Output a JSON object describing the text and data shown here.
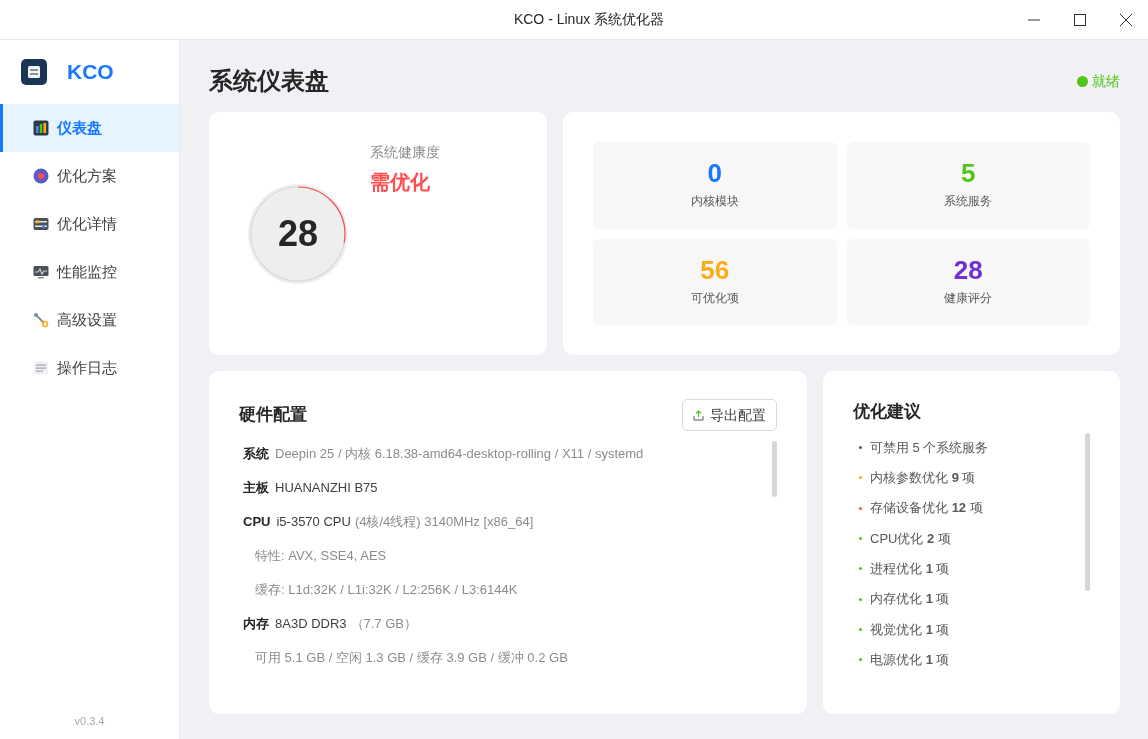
{
  "window": {
    "title": "KCO - Linux 系统优化器"
  },
  "sidebar": {
    "app_name": "KCO",
    "items": [
      {
        "label": "仪表盘",
        "selected": true
      },
      {
        "label": "优化方案",
        "selected": false
      },
      {
        "label": "优化详情",
        "selected": false
      },
      {
        "label": "性能监控",
        "selected": false
      },
      {
        "label": "高级设置",
        "selected": false
      },
      {
        "label": "操作日志",
        "selected": false
      }
    ],
    "version": "v0.3.4"
  },
  "header": {
    "title": "系统仪表盘",
    "status": {
      "label": "就绪",
      "color": "#52c41a"
    }
  },
  "health": {
    "score": "28",
    "level": 0.28,
    "caption": "系统健康度",
    "verdict": "需优化"
  },
  "stats": [
    {
      "value": "0",
      "label": "内核模块",
      "color": "#1677ff"
    },
    {
      "value": "5",
      "label": "系统服务",
      "color": "#52c41a"
    },
    {
      "value": "56",
      "label": "可优化项",
      "color": "#faad14"
    },
    {
      "value": "28",
      "label": "健康评分",
      "color": "#722ed1"
    }
  ],
  "hardware": {
    "title": "硬件配置",
    "export_button": "导出配置",
    "rows": [
      {
        "kind": "main",
        "label": "系统",
        "detail": "Deepin 25 / 内核 6.18.38-amd64-desktop-rolling / X11 / systemd"
      },
      {
        "kind": "main",
        "label": "主板",
        "value": "HUANANZHI B75"
      },
      {
        "kind": "main",
        "label": "CPU",
        "value": "i5-3570 CPU",
        "detail": "(4核/4线程) 3140MHz [x86_64]"
      },
      {
        "kind": "sub",
        "text": "特性: AVX, SSE4, AES"
      },
      {
        "kind": "sub",
        "text": "缓存: L1d:32K / L1i:32K / L2:256K / L3:6144K"
      },
      {
        "kind": "main",
        "label": "内存",
        "value": "8A3D DDR3",
        "detail": "（7.7 GB）"
      },
      {
        "kind": "sub",
        "text": "可用 5.1 GB / 空闲 1.3 GB / 缓存 3.9 GB / 缓冲 0.2 GB"
      }
    ]
  },
  "suggestions": {
    "title": "优化建议",
    "items": [
      {
        "text": "可禁用 5 个系统服务",
        "color": "#595959"
      },
      {
        "text": "内核参数优化 **9** 项",
        "color": "#faad14"
      },
      {
        "text": "存储设备优化 **12** 项",
        "color": "#ff4d4f"
      },
      {
        "text": "CPU优化 **2** 项",
        "color": "#52c41a"
      },
      {
        "text": "进程优化 **1** 项",
        "color": "#52c41a"
      },
      {
        "text": "内存优化 **1** 项",
        "color": "#52c41a"
      },
      {
        "text": "视觉优化 **1** 项",
        "color": "#52c41a"
      },
      {
        "text": "电源优化 **1** 项",
        "color": "#52c41a"
      }
    ]
  }
}
